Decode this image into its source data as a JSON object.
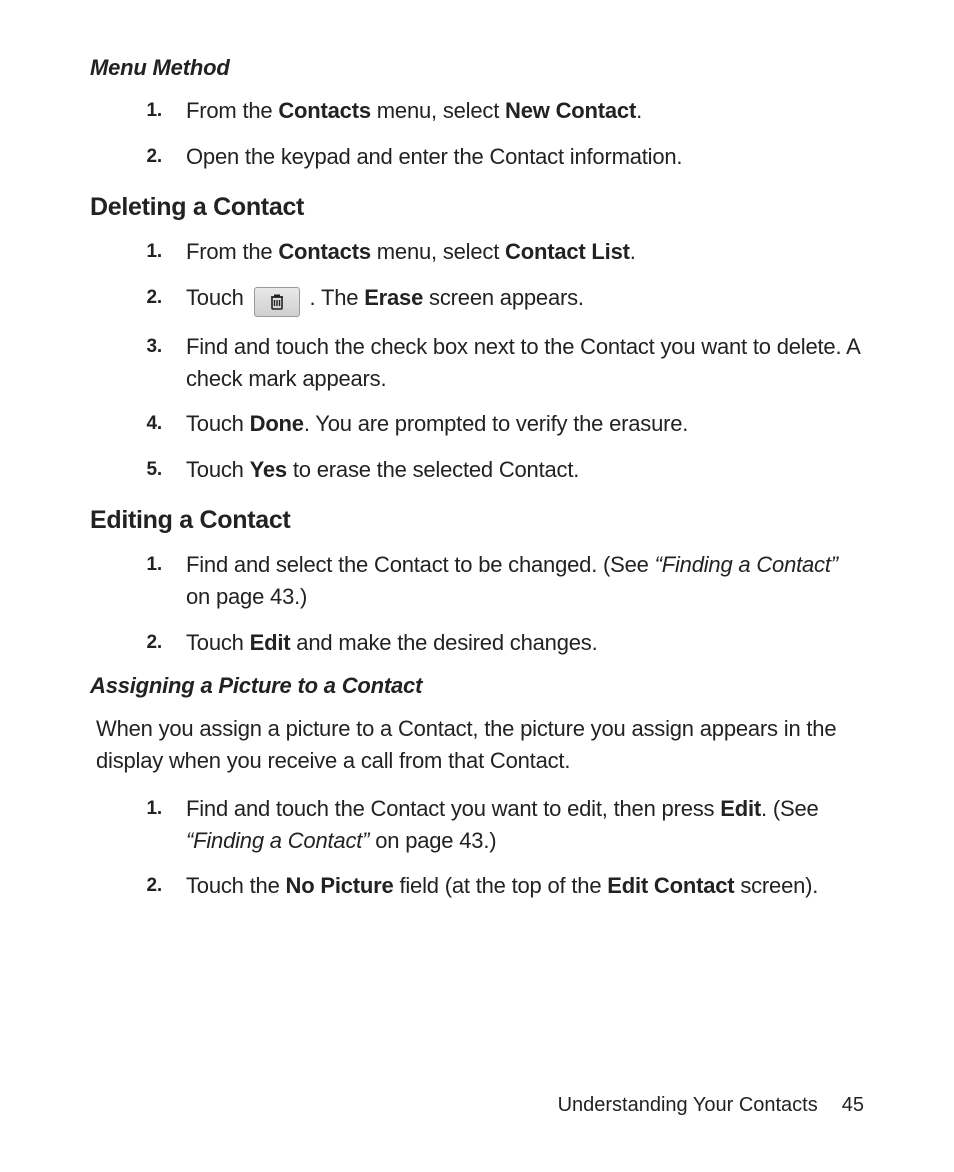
{
  "section1_title": "Menu Method",
  "section1_steps": {
    "s1": {
      "n": "1.",
      "pre": "From the ",
      "b1": "Contacts",
      "mid": " menu, select ",
      "b2": "New Contact",
      "post": "."
    },
    "s2": {
      "n": "2.",
      "text": "Open the keypad and enter the Contact information."
    }
  },
  "section2_title": "Deleting a Contact",
  "section2_steps": {
    "s1": {
      "n": "1.",
      "pre": "From the ",
      "b1": "Contacts",
      "mid": " menu, select ",
      "b2": "Contact List",
      "post": "."
    },
    "s2": {
      "n": "2.",
      "pre": "Touch ",
      "mid": " . The ",
      "b1": "Erase",
      "post": " screen appears."
    },
    "s3": {
      "n": "3.",
      "text": "Find and touch the check box next to the Contact you want to delete. A check mark appears."
    },
    "s4": {
      "n": "4.",
      "pre": "Touch ",
      "b1": "Done",
      "post": ". You are prompted to verify the erasure."
    },
    "s5": {
      "n": "5.",
      "pre": "Touch ",
      "b1": "Yes",
      "post": " to erase the selected Contact."
    }
  },
  "section3_title": "Editing a Contact",
  "section3_steps": {
    "s1": {
      "n": "1.",
      "pre": "Find and select the Contact to be changed. (See ",
      "i1": "“Finding a Contact”",
      "post": " on page 43.)"
    },
    "s2": {
      "n": "2.",
      "pre": "Touch ",
      "b1": "Edit",
      "post": " and make the desired changes."
    }
  },
  "section4_title": "Assigning a Picture to a Contact",
  "section4_para": "When you assign a picture to a Contact, the picture you assign appears in the display when you receive a call from that Contact.",
  "section4_steps": {
    "s1": {
      "n": "1.",
      "pre": "Find and touch the Contact you want to edit, then press ",
      "b1": "Edit",
      "mid": ". (See ",
      "i1": "“Finding a Contact”",
      "post": " on page 43.)"
    },
    "s2": {
      "n": "2.",
      "pre": "Touch the ",
      "b1": "No Picture",
      "mid": " field (at the top of the ",
      "b2": "Edit Contact",
      "post": " screen)."
    }
  },
  "footer_text": "Understanding Your Contacts",
  "page_number": "45"
}
